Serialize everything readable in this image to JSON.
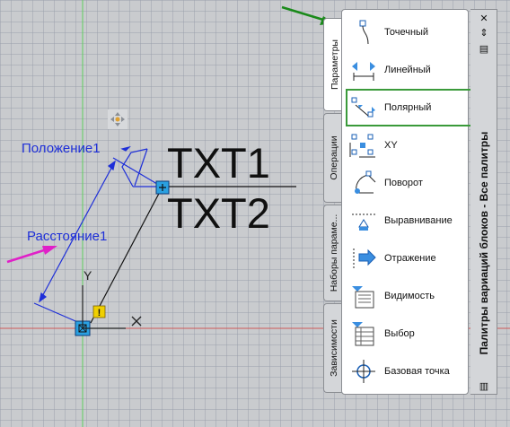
{
  "drawing": {
    "label_position": "Положение1",
    "label_distance": "Расстояние1",
    "text_top": "TXT1",
    "text_bottom": "TXT2",
    "axis_y": "Y",
    "axis_x": "X"
  },
  "palette": {
    "title": "Палитры вариаций блоков - Все палитры",
    "tabs": [
      {
        "label": "Параметры"
      },
      {
        "label": "Операции"
      },
      {
        "label": "Наборы параме..."
      },
      {
        "label": "Зависимости"
      }
    ],
    "items": [
      {
        "label": "Точечный",
        "icon": "point-parameter-icon"
      },
      {
        "label": "Линейный",
        "icon": "linear-parameter-icon"
      },
      {
        "label": "Полярный",
        "icon": "polar-parameter-icon",
        "selected": true
      },
      {
        "label": "XY",
        "icon": "xy-parameter-icon"
      },
      {
        "label": "Поворот",
        "icon": "rotation-parameter-icon"
      },
      {
        "label": "Выравнивание",
        "icon": "alignment-parameter-icon"
      },
      {
        "label": "Отражение",
        "icon": "flip-parameter-icon"
      },
      {
        "label": "Видимость",
        "icon": "visibility-parameter-icon"
      },
      {
        "label": "Выбор",
        "icon": "lookup-parameter-icon"
      },
      {
        "label": "Базовая точка",
        "icon": "base-point-parameter-icon"
      }
    ]
  },
  "colors": {
    "annotation_blue": "#1e2fd8",
    "arrow_green": "#1a8a1a",
    "arrow_magenta": "#e020c8",
    "selection_green": "#3a9a3a"
  }
}
